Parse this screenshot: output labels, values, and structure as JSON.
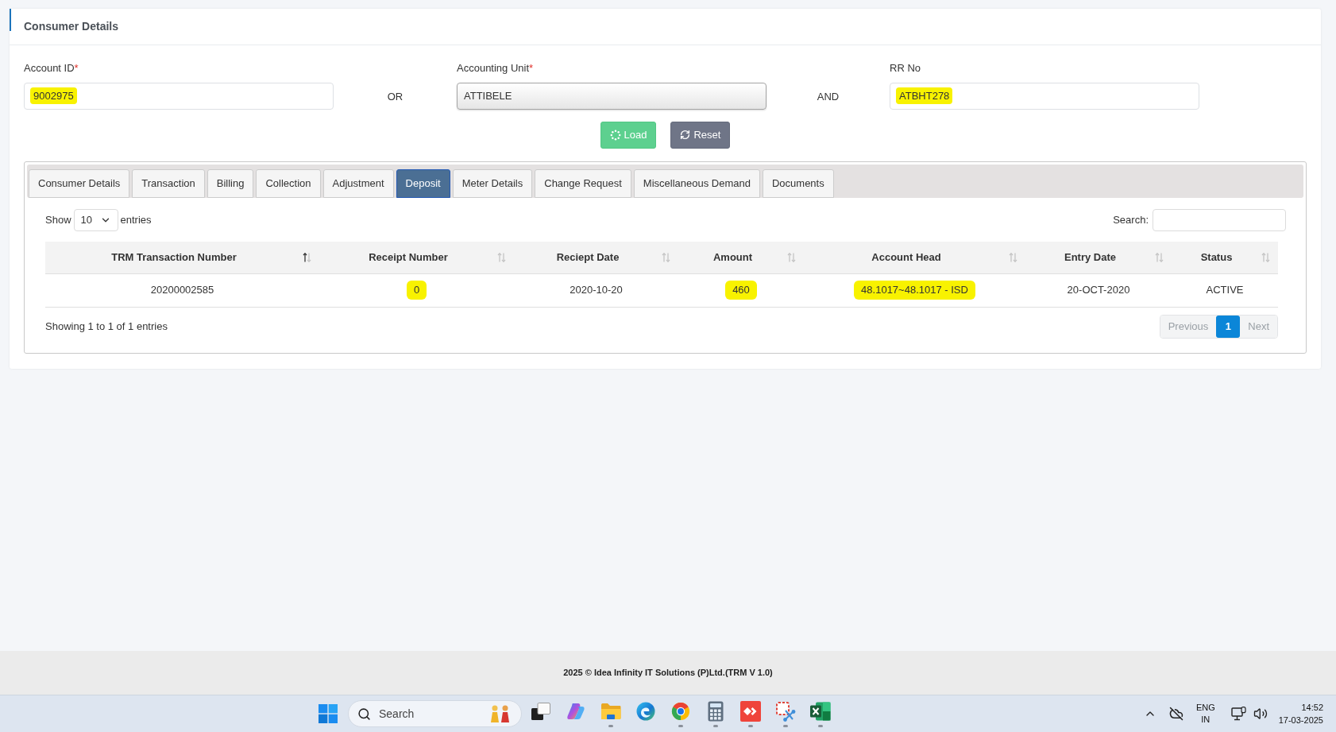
{
  "card": {
    "title": "Consumer Details"
  },
  "form": {
    "fields": [
      {
        "kind": "input",
        "label": "Account ID",
        "required_mark": "*",
        "value": "9002975",
        "highlighted": true
      },
      {
        "kind": "select",
        "label": "Accounting Unit",
        "required_mark": "*",
        "value": "ATTIBELE",
        "highlighted": false
      },
      {
        "kind": "input",
        "label": "RR No",
        "value": "ATBHT278",
        "highlighted": true
      }
    ],
    "connectors": [
      "OR",
      "AND"
    ],
    "buttons": [
      {
        "kind": "load",
        "label": "Load"
      },
      {
        "kind": "reset",
        "label": "Reset"
      }
    ]
  },
  "tabs": [
    {
      "label": "Consumer Details",
      "selected": false
    },
    {
      "label": "Transaction",
      "selected": false
    },
    {
      "label": "Billing",
      "selected": false
    },
    {
      "label": "Collection",
      "selected": false
    },
    {
      "label": "Adjustment",
      "selected": false
    },
    {
      "label": "Deposit",
      "selected": true
    },
    {
      "label": "Meter Details",
      "selected": false
    },
    {
      "label": "Change Request",
      "selected": false
    },
    {
      "label": "Miscellaneous Demand",
      "selected": false
    },
    {
      "label": "Documents",
      "selected": false
    }
  ],
  "table": {
    "length": {
      "before": "Show",
      "value": "10",
      "after": "entries"
    },
    "search": {
      "label": "Search:"
    },
    "columns": [
      {
        "label": "TRM Transaction Number",
        "sorted_ascending": true
      },
      {
        "label": "Receipt Number",
        "sorted_ascending": false
      },
      {
        "label": "Reciept Date",
        "sorted_ascending": false
      },
      {
        "label": "Amount",
        "sorted_ascending": false
      },
      {
        "label": "Account Head",
        "sorted_ascending": false
      },
      {
        "label": "Entry Date",
        "sorted_ascending": false
      },
      {
        "label": "Status",
        "sorted_ascending": false
      }
    ],
    "rows": [
      {
        "cells": [
          {
            "text": "20200002585",
            "highlighted": false
          },
          {
            "text": "0",
            "highlighted": true
          },
          {
            "text": "2020-10-20",
            "highlighted": false
          },
          {
            "text": "460",
            "highlighted": true
          },
          {
            "text": "48.1017~48.1017 - ISD",
            "highlighted": true
          },
          {
            "text": "20-OCT-2020",
            "highlighted": false
          },
          {
            "text": "ACTIVE",
            "highlighted": false
          }
        ]
      }
    ],
    "info": "Showing 1 to 1 of 1 entries",
    "pagination": {
      "previous": {
        "label": "Previous",
        "disabled": true
      },
      "pages": [
        {
          "label": "1",
          "selected": true
        }
      ],
      "next": {
        "label": "Next",
        "disabled": true
      }
    }
  },
  "footer": {
    "text": "2025 © Idea Infinity IT Solutions (P)Ltd.(TRM V 1.0)"
  },
  "taskbar": {
    "search": {
      "placeholder": "Search"
    },
    "apps": [
      {
        "kind": "task-view",
        "running": false
      },
      {
        "kind": "copilot",
        "running": false
      },
      {
        "kind": "file-explorer",
        "running": true
      },
      {
        "kind": "edge",
        "running": false
      },
      {
        "kind": "chrome",
        "running": true
      },
      {
        "kind": "calculator",
        "running": true
      },
      {
        "kind": "anydesk",
        "running": true
      },
      {
        "kind": "snipping-tool",
        "running": true
      },
      {
        "kind": "excel",
        "running": true
      }
    ],
    "tray": {
      "language": [
        "ENG",
        "IN"
      ],
      "time": "14:52",
      "date": "17-03-2025"
    }
  }
}
